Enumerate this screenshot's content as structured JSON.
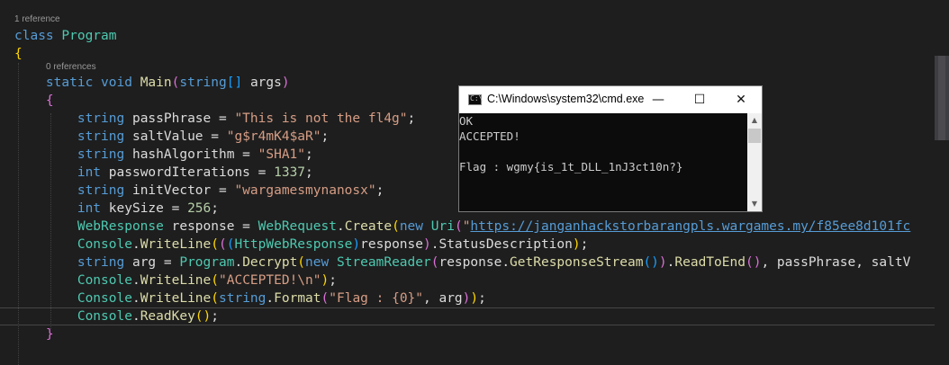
{
  "editor": {
    "codelens_class": "1 reference",
    "codelens_main": "0 references",
    "code": {
      "class_kw": "class",
      "class_name": "Program",
      "open_brace_1": "{",
      "main_static": "static",
      "main_void": "void",
      "main_name": "Main",
      "main_paren_open": "(",
      "main_string": "string",
      "main_bracket": "[]",
      "main_args": " args",
      "main_paren_close": ")",
      "open_brace_2": "{",
      "l1_type": "string",
      "l1_mid": " passPhrase = ",
      "l1_value": "\"This is not the fl4g\"",
      "l1_end": ";",
      "l2_type": "string",
      "l2_mid": " saltValue = ",
      "l2_value": "\"g$r4mK4$aR\"",
      "l2_end": ";",
      "l3_type": "string",
      "l3_mid": " hashAlgorithm = ",
      "l3_value": "\"SHA1\"",
      "l3_end": ";",
      "l4_type": "int",
      "l4_mid": " passwordIterations = ",
      "l4_value": "1337",
      "l4_end": ";",
      "l5_type": "string",
      "l5_mid": " initVector = ",
      "l5_value": "\"wargamesmynanosx\"",
      "l5_end": ";",
      "l6_type": "int",
      "l6_mid": " keySize = ",
      "l6_value": "256",
      "l6_end": ";",
      "l7_type": "WebResponse",
      "l7_mid": " response = ",
      "l7_class": "WebRequest",
      "l7_dot": ".",
      "l7_method": "Create",
      "l7_p_open": "(",
      "l7_new": "new",
      "l7_space": " ",
      "l7_uri": "Uri",
      "l7_p_open2": "(",
      "l7_quote": "\"",
      "l7_url": "https://janganhackstorbarangpls.wargames.my/f85ee8d101fc",
      "l8_class": "Console",
      "l8_dot": ".",
      "l8_method": "WriteLine",
      "l8_p1": "(",
      "l8_p2": "(",
      "l8_p3": "(",
      "l8_cast": "HttpWebResponse",
      "l8_p3c": ")",
      "l8_resp": "response",
      "l8_p2c": ")",
      "l8_dot2": ".",
      "l8_prop": "StatusDescription",
      "l8_p1c": ")",
      "l8_end": ";",
      "l9_type": "string",
      "l9_mid": " arg = ",
      "l9_class": "Program",
      "l9_dot": ".",
      "l9_method": "Decrypt",
      "l9_p1": "(",
      "l9_new": "new",
      "l9_space": " ",
      "l9_sr": "StreamReader",
      "l9_p2": "(",
      "l9_resp": "response",
      "l9_dot2": ".",
      "l9_grs": "GetResponseStream",
      "l9_p3": "()",
      "l9_p2c": ")",
      "l9_dot3": ".",
      "l9_rte": "ReadToEnd",
      "l9_p4": "()",
      "l9_rest": ", passPhrase, saltV",
      "l10_class": "Console",
      "l10_dot": ".",
      "l10_method": "WriteLine",
      "l10_p1": "(",
      "l10_str": "\"ACCEPTED!\\n\"",
      "l10_p1c": ")",
      "l10_end": ";",
      "l11_class": "Console",
      "l11_dot": ".",
      "l11_method": "WriteLine",
      "l11_p1": "(",
      "l11_string": "string",
      "l11_dot2": ".",
      "l11_format": "Format",
      "l11_p2": "(",
      "l11_str": "\"Flag : {0}\"",
      "l11_comma": ", arg",
      "l11_p2c": ")",
      "l11_p1c": ")",
      "l11_end": ";",
      "l12_class": "Console",
      "l12_dot": ".",
      "l12_method": "ReadKey",
      "l12_p": "()",
      "l12_end": ";",
      "close_brace_2": "}"
    }
  },
  "cmd_window": {
    "title": "C:\\Windows\\system32\\cmd.exe",
    "icon_text": "C:\\",
    "minimize": "—",
    "maximize": "☐",
    "close": "✕",
    "output": [
      "OK",
      "ACCEPTED!",
      "",
      "Flag : wgmy{is_1t_DLL_1nJ3ct10n?}"
    ],
    "scroll_up": "▲",
    "scroll_down": "▼"
  }
}
